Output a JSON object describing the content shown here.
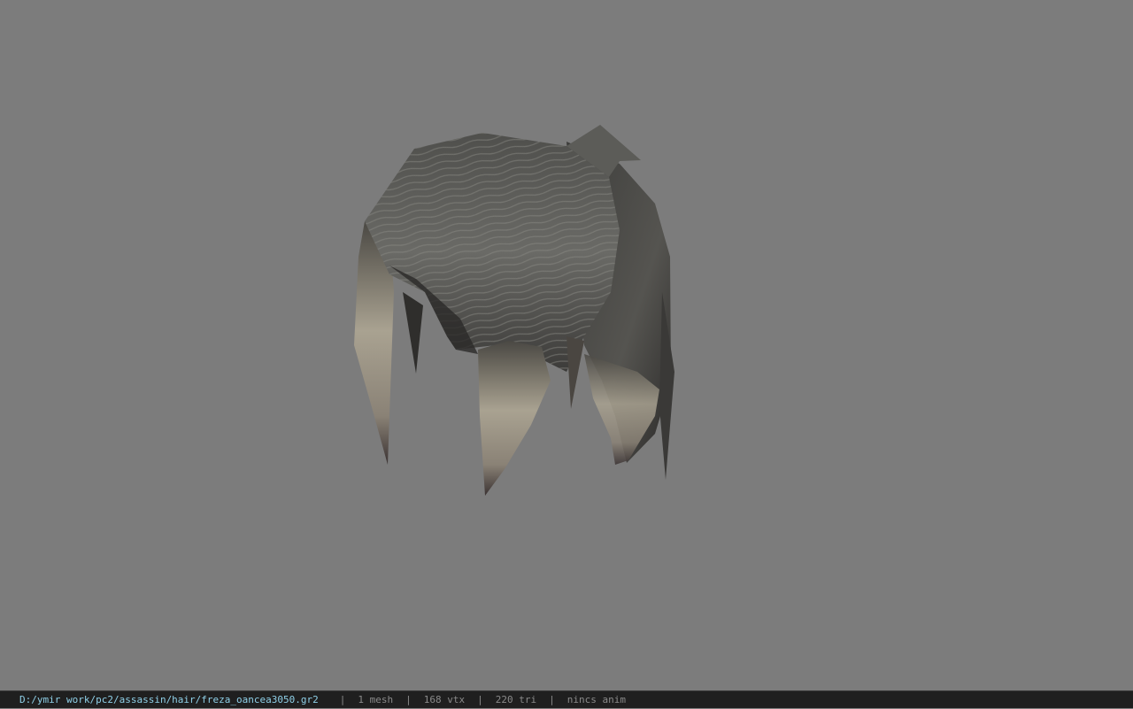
{
  "viewer": {
    "background_color": "#7c7c7c",
    "model_name": "hair-mesh"
  },
  "statusbar": {
    "file_path": "D:/ymir work/pc2/assassin/hair/freza_oancea3050.gr2",
    "separator": "|",
    "mesh_count": "1 mesh",
    "vertex_count": "168 vtx",
    "triangle_count": "220 tri",
    "anim_status": "nincs anim",
    "path_color": "#8fd0e8",
    "text_color": "#8a8a8a"
  }
}
